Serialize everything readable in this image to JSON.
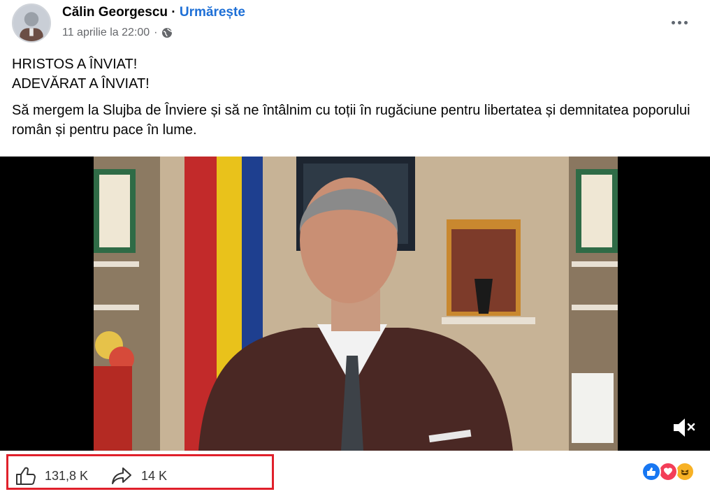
{
  "post": {
    "author": "Călin Georgescu",
    "separator": "·",
    "follow_label": "Urmărește",
    "timestamp": "11 aprilie la 22:00",
    "privacy_icon": "globe-icon",
    "more_icon": "more-horizontal-icon",
    "line1": "HRISTOS A ÎNVIAT!",
    "line2": "ADEVĂRAT A ÎNVIAT!",
    "body": "Să mergem la Slujba de Înviere și să ne întâlnim cu toții în rugăciune pentru libertatea și demnitatea poporului român și pentru pace în lume."
  },
  "video": {
    "mute_icon": "muted-speaker-icon"
  },
  "footer": {
    "likes": "131,8 K",
    "like_icon": "thumbs-up-icon",
    "shares": "14 K",
    "share_icon": "share-arrow-icon",
    "reactions": [
      "like",
      "love",
      "haha"
    ]
  },
  "colors": {
    "accent": "#1d6fd6",
    "highlight_box": "#e0202b",
    "like": "#1877f2",
    "love": "#f33e58",
    "haha": "#f7b125"
  }
}
